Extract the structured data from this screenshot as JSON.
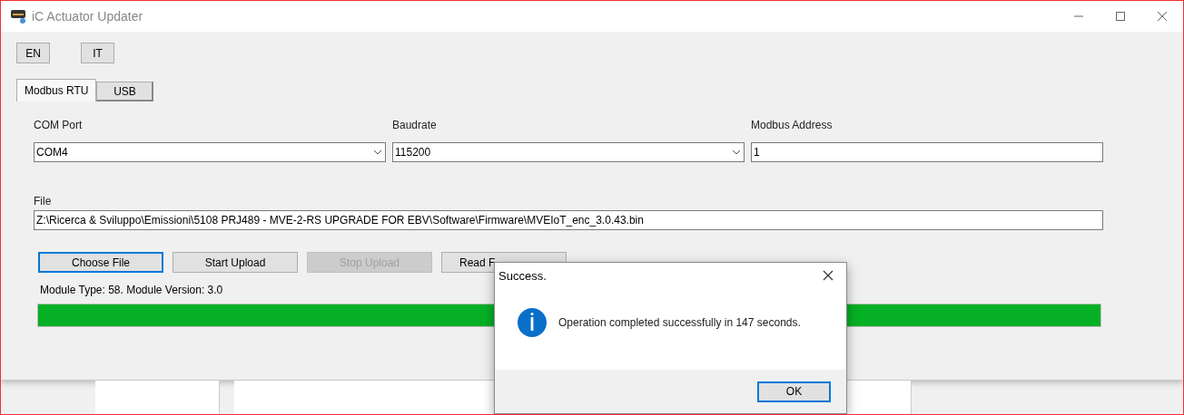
{
  "window": {
    "title": "iC Actuator Updater"
  },
  "languages": [
    {
      "label": "EN"
    },
    {
      "label": "IT"
    }
  ],
  "tabs": [
    {
      "label": "Modbus RTU",
      "selected": true
    },
    {
      "label": "USB",
      "selected": false
    }
  ],
  "fields": [
    {
      "kind": "combo",
      "label": "COM Port",
      "value": "COM4"
    },
    {
      "kind": "combo",
      "label": "Baudrate",
      "value": "115200"
    },
    {
      "kind": "text",
      "label": "Modbus Address",
      "value": "1"
    }
  ],
  "file": {
    "label": "File",
    "value": "Z:\\Ricerca & Sviluppo\\Emissioni\\5108 PRJ489 - MVE-2-RS UPGRADE FOR EBV\\Software\\Firmware\\MVEIoT_enc_3.0.43.bin"
  },
  "buttons": [
    {
      "label": "Choose File",
      "focused": true,
      "disabled": false
    },
    {
      "label": "Start Upload",
      "focused": false,
      "disabled": false
    },
    {
      "label": "Stop Upload",
      "focused": false,
      "disabled": true
    },
    {
      "label": "Read F",
      "focused": false,
      "disabled": false
    }
  ],
  "status": "Module Type: 58. Module Version: 3.0",
  "progress": {
    "level": 1
  },
  "dialog": {
    "title": "Success.",
    "message": "Operation completed successfully in 147 seconds.",
    "button": "OK"
  }
}
